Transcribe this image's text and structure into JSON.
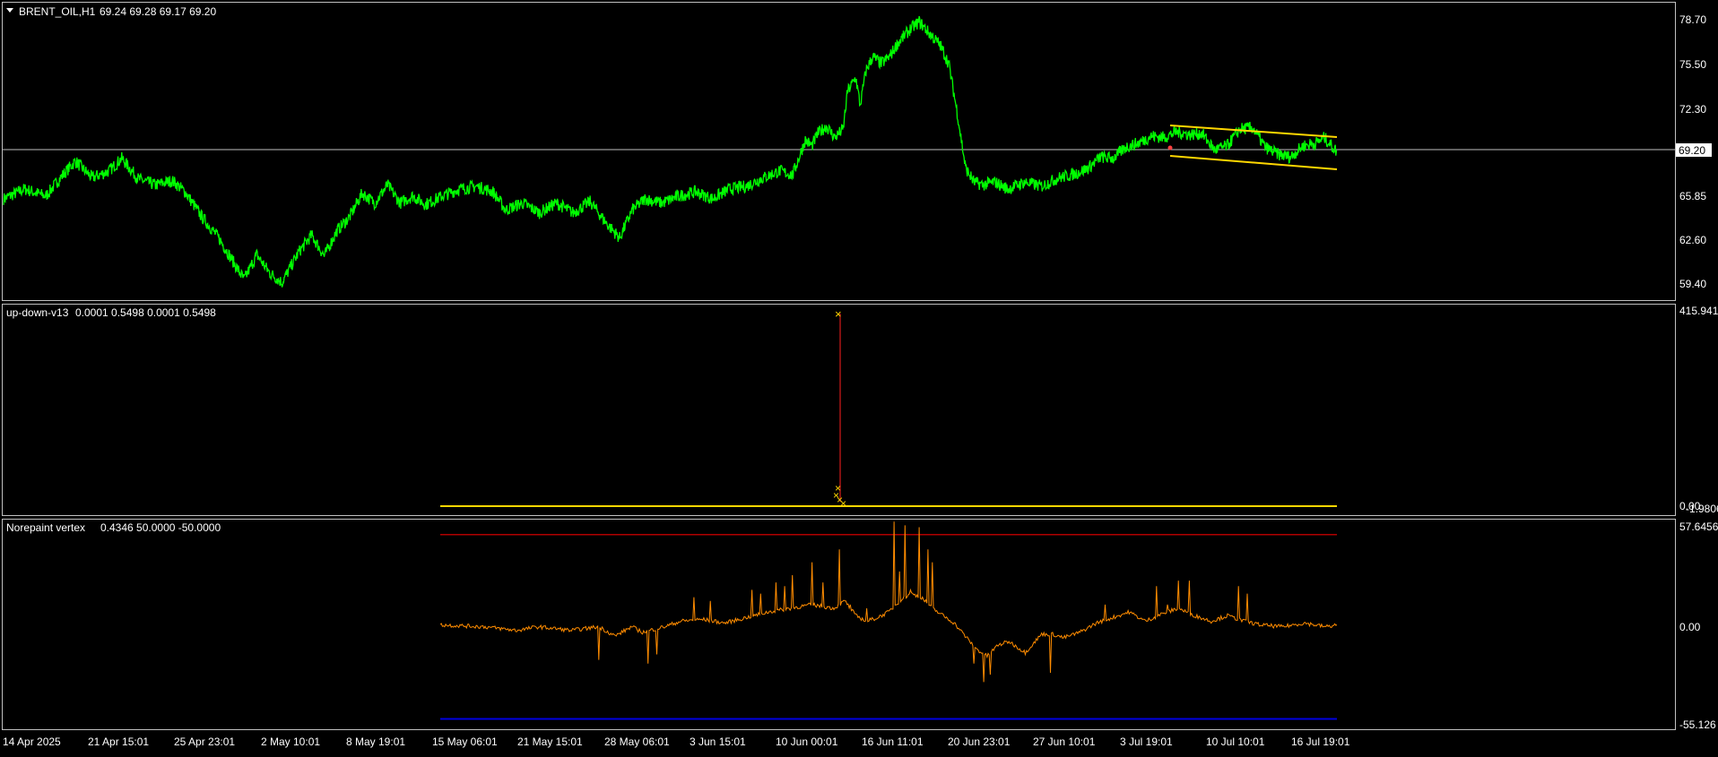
{
  "window": {
    "symbol_header": "BRENT_OIL,H1",
    "ohlc_header": "69.24 69.28 69.17 69.20"
  },
  "chart_data": [
    {
      "type": "line",
      "panel": "price",
      "series": [
        {
          "name": "BRENT_OIL,H1",
          "color": "#00ff00"
        }
      ],
      "y_ticks": [
        "78.70",
        "75.50",
        "72.30",
        "69.20",
        "65.85",
        "62.60",
        "59.40"
      ],
      "y_tick_values": [
        78.7,
        75.5,
        72.3,
        69.2,
        65.85,
        62.6,
        59.4
      ],
      "current_price": "69.20",
      "current_price_value": 69.2,
      "ylim": [
        58.6,
        79.8
      ],
      "anchors": [
        [
          0,
          65.8
        ],
        [
          25,
          66.5
        ],
        [
          50,
          66.0
        ],
        [
          70,
          67.5
        ],
        [
          85,
          68.5
        ],
        [
          105,
          67.3
        ],
        [
          125,
          67.8
        ],
        [
          140,
          68.7
        ],
        [
          160,
          67.2
        ],
        [
          180,
          66.8
        ],
        [
          200,
          67.1
        ],
        [
          215,
          66.3
        ],
        [
          235,
          64.5
        ],
        [
          255,
          63.0
        ],
        [
          270,
          61.5
        ],
        [
          285,
          60.0
        ],
        [
          300,
          61.8
        ],
        [
          315,
          60.5
        ],
        [
          330,
          59.8
        ],
        [
          350,
          62.0
        ],
        [
          365,
          63.2
        ],
        [
          380,
          61.7
        ],
        [
          395,
          63.5
        ],
        [
          410,
          64.5
        ],
        [
          425,
          66.2
        ],
        [
          440,
          65.5
        ],
        [
          455,
          66.8
        ],
        [
          470,
          65.5
        ],
        [
          485,
          66.0
        ],
        [
          500,
          65.4
        ],
        [
          520,
          66.0
        ],
        [
          540,
          66.5
        ],
        [
          560,
          66.7
        ],
        [
          580,
          66.3
        ],
        [
          595,
          65.0
        ],
        [
          615,
          65.5
        ],
        [
          635,
          64.8
        ],
        [
          655,
          65.5
        ],
        [
          675,
          64.8
        ],
        [
          695,
          65.6
        ],
        [
          715,
          64.0
        ],
        [
          730,
          63.0
        ],
        [
          745,
          65.0
        ],
        [
          760,
          65.8
        ],
        [
          780,
          65.5
        ],
        [
          800,
          66.0
        ],
        [
          820,
          66.3
        ],
        [
          840,
          65.8
        ],
        [
          860,
          66.5
        ],
        [
          880,
          66.7
        ],
        [
          900,
          67.3
        ],
        [
          920,
          67.8
        ],
        [
          935,
          67.5
        ],
        [
          950,
          70.0
        ],
        [
          958,
          69.6
        ],
        [
          965,
          70.5
        ],
        [
          975,
          71.0
        ],
        [
          985,
          70.2
        ],
        [
          995,
          70.8
        ],
        [
          1000,
          73.5
        ],
        [
          1010,
          74.5
        ],
        [
          1015,
          72.5
        ],
        [
          1022,
          75.0
        ],
        [
          1030,
          76.0
        ],
        [
          1040,
          75.5
        ],
        [
          1050,
          76.0
        ],
        [
          1060,
          77.0
        ],
        [
          1075,
          78.0
        ],
        [
          1085,
          78.5
        ],
        [
          1095,
          77.8
        ],
        [
          1110,
          76.8
        ],
        [
          1120,
          75.5
        ],
        [
          1130,
          72.0
        ],
        [
          1140,
          68.0
        ],
        [
          1150,
          67.0
        ],
        [
          1160,
          66.8
        ],
        [
          1175,
          67.0
        ],
        [
          1190,
          66.5
        ],
        [
          1210,
          67.0
        ],
        [
          1230,
          66.7
        ],
        [
          1250,
          67.3
        ],
        [
          1270,
          67.6
        ],
        [
          1285,
          68.0
        ],
        [
          1300,
          68.8
        ],
        [
          1315,
          68.7
        ],
        [
          1330,
          69.5
        ],
        [
          1345,
          69.8
        ],
        [
          1360,
          70.3
        ],
        [
          1375,
          70.2
        ],
        [
          1390,
          70.6
        ],
        [
          1405,
          70.4
        ],
        [
          1420,
          70.5
        ],
        [
          1435,
          69.3
        ],
        [
          1450,
          69.6
        ],
        [
          1465,
          70.8
        ],
        [
          1480,
          70.9
        ],
        [
          1495,
          69.5
        ],
        [
          1510,
          69.0
        ],
        [
          1525,
          68.8
        ],
        [
          1540,
          69.6
        ],
        [
          1555,
          69.8
        ],
        [
          1565,
          70.2
        ],
        [
          1575,
          69.5
        ],
        [
          1580,
          69.2
        ]
      ]
    },
    {
      "type": "line",
      "panel": "indicator",
      "name": "up-down-v13",
      "header_values": "0.0001 0.5498 0.0001 0.5498",
      "y_ticks": [
        "415.941",
        "0.00",
        "-1.9806"
      ],
      "ylim": [
        0,
        415.941
      ],
      "spike_value": 415.941,
      "series": [
        {
          "name": "up-down-v13",
          "color": "#ffd700"
        }
      ]
    },
    {
      "type": "line",
      "panel": "indicator",
      "name": "Norepaint vertex",
      "header_values": "0.4346 50.0000 -50.0000",
      "y_ticks": [
        "57.6456",
        "0.00",
        "-55.126"
      ],
      "y_tick_values": [
        57.6456,
        0.0,
        -55.126
      ],
      "ylim": [
        -55.126,
        57.6456
      ],
      "levels": [
        {
          "value": 50.0,
          "color": "#b00000"
        },
        {
          "value": -50.0,
          "color": "#0000e0"
        }
      ],
      "series": [
        {
          "name": "Norepaint vertex",
          "color": "#ff8c00"
        }
      ],
      "anchors": [
        [
          400,
          1
        ],
        [
          440,
          0
        ],
        [
          470,
          -2
        ],
        [
          490,
          0
        ],
        [
          520,
          -2
        ],
        [
          545,
          0
        ],
        [
          560,
          -5
        ],
        [
          575,
          0
        ],
        [
          585,
          -3
        ],
        [
          605,
          0
        ],
        [
          620,
          3
        ],
        [
          640,
          4
        ],
        [
          660,
          2
        ],
        [
          680,
          5
        ],
        [
          700,
          8
        ],
        [
          720,
          10
        ],
        [
          740,
          12
        ],
        [
          760,
          10
        ],
        [
          770,
          14
        ],
        [
          780,
          6
        ],
        [
          790,
          3
        ],
        [
          800,
          5
        ],
        [
          810,
          8
        ],
        [
          820,
          14
        ],
        [
          830,
          18
        ],
        [
          840,
          16
        ],
        [
          850,
          10
        ],
        [
          860,
          6
        ],
        [
          870,
          2
        ],
        [
          880,
          -5
        ],
        [
          890,
          -12
        ],
        [
          900,
          -16
        ],
        [
          910,
          -10
        ],
        [
          920,
          -8
        ],
        [
          935,
          -14
        ],
        [
          950,
          -4
        ],
        [
          960,
          -4
        ],
        [
          970,
          -6
        ],
        [
          985,
          -3
        ],
        [
          1000,
          2
        ],
        [
          1015,
          5
        ],
        [
          1030,
          8
        ],
        [
          1045,
          3
        ],
        [
          1060,
          7
        ],
        [
          1075,
          10
        ],
        [
          1090,
          6
        ],
        [
          1105,
          3
        ],
        [
          1120,
          6
        ],
        [
          1135,
          3
        ],
        [
          1150,
          1
        ],
        [
          1170,
          0
        ],
        [
          1190,
          2
        ],
        [
          1210,
          0
        ],
        [
          1220,
          1
        ]
      ],
      "spikes": [
        [
          545,
          -18
        ],
        [
          590,
          -20
        ],
        [
          598,
          -15
        ],
        [
          632,
          16
        ],
        [
          647,
          14
        ],
        [
          685,
          20
        ],
        [
          693,
          18
        ],
        [
          707,
          24
        ],
        [
          715,
          22
        ],
        [
          722,
          28
        ],
        [
          740,
          35
        ],
        [
          750,
          24
        ],
        [
          765,
          42
        ],
        [
          775,
          12
        ],
        [
          790,
          10
        ],
        [
          815,
          57
        ],
        [
          820,
          30
        ],
        [
          825,
          55
        ],
        [
          830,
          20
        ],
        [
          838,
          54
        ],
        [
          846,
          42
        ],
        [
          850,
          35
        ],
        [
          888,
          -20
        ],
        [
          897,
          -30
        ],
        [
          903,
          -26
        ],
        [
          958,
          -25
        ],
        [
          1008,
          12
        ],
        [
          1055,
          22
        ],
        [
          1065,
          12
        ],
        [
          1075,
          25
        ],
        [
          1085,
          25
        ],
        [
          1130,
          22
        ],
        [
          1138,
          18
        ]
      ]
    }
  ],
  "x_axis": {
    "labels": [
      "14 Apr 2025",
      "21 Apr 15:01",
      "25 Apr 23:01",
      "2 May 10:01",
      "8 May 19:01",
      "15 May 06:01",
      "21 May 15:01",
      "28 May 06:01",
      "3 Jun 15:01",
      "10 Jun 00:01",
      "16 Jun 11:01",
      "20 Jun 23:01",
      "27 Jun 10:01",
      "3 Jul 19:01",
      "10 Jul 10:01",
      "16 Jul 19:01"
    ]
  },
  "colors": {
    "background": "#000000",
    "border": "#c0c0c0",
    "price_line": "#00ff00",
    "channel": "#ffd700",
    "current_price_line": "#c0c0c0",
    "updown_line": "#ffd700",
    "updown_spike": "#ff2020",
    "vertex_line": "#ff8c00",
    "level_high": "#b00000",
    "level_low": "#0000e0",
    "text": "#ffffff"
  }
}
